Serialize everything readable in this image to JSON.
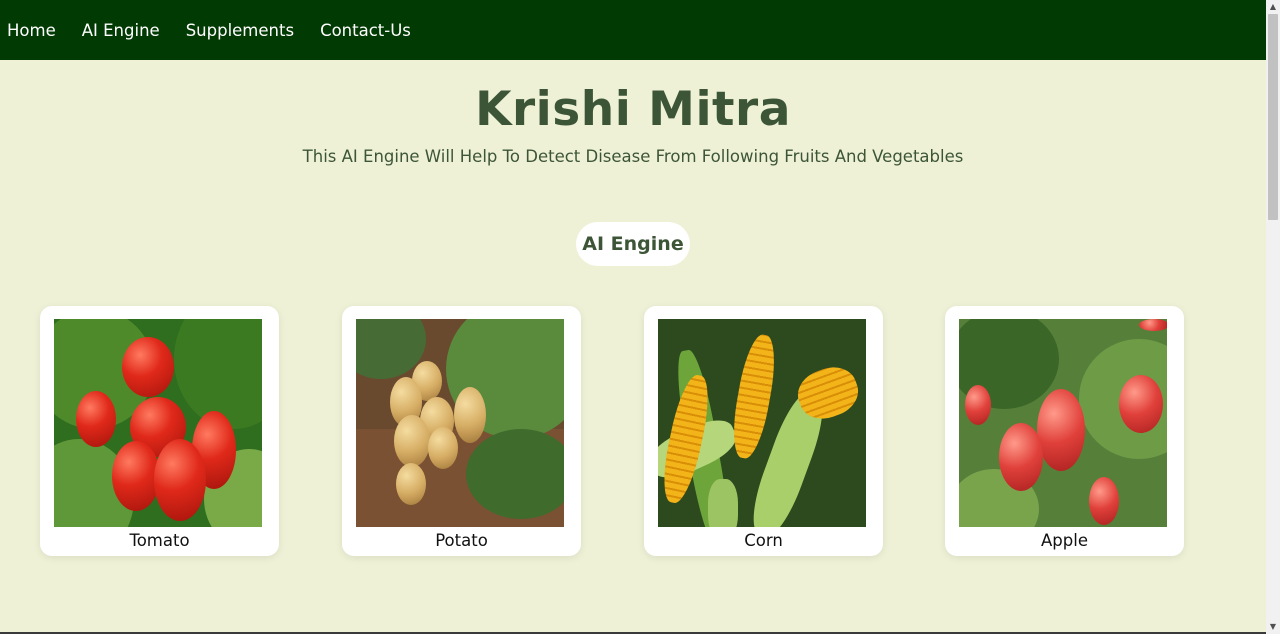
{
  "nav": {
    "items": [
      {
        "label": "Home"
      },
      {
        "label": "AI Engine"
      },
      {
        "label": "Supplements"
      },
      {
        "label": "Contact-Us"
      }
    ]
  },
  "hero": {
    "title": "Krishi Mitra",
    "subtitle": "This AI Engine Will Help To Detect Disease From Following Fruits And Vegetables"
  },
  "section": {
    "label": "AI Engine"
  },
  "cards": [
    {
      "label": "Tomato",
      "icon": "tomato-image"
    },
    {
      "label": "Potato",
      "icon": "potato-image"
    },
    {
      "label": "Corn",
      "icon": "corn-image"
    },
    {
      "label": "Apple",
      "icon": "apple-image"
    }
  ],
  "colors": {
    "nav_background": "#023a04",
    "page_background": "#eef1d6",
    "heading_text": "#3d5537"
  }
}
